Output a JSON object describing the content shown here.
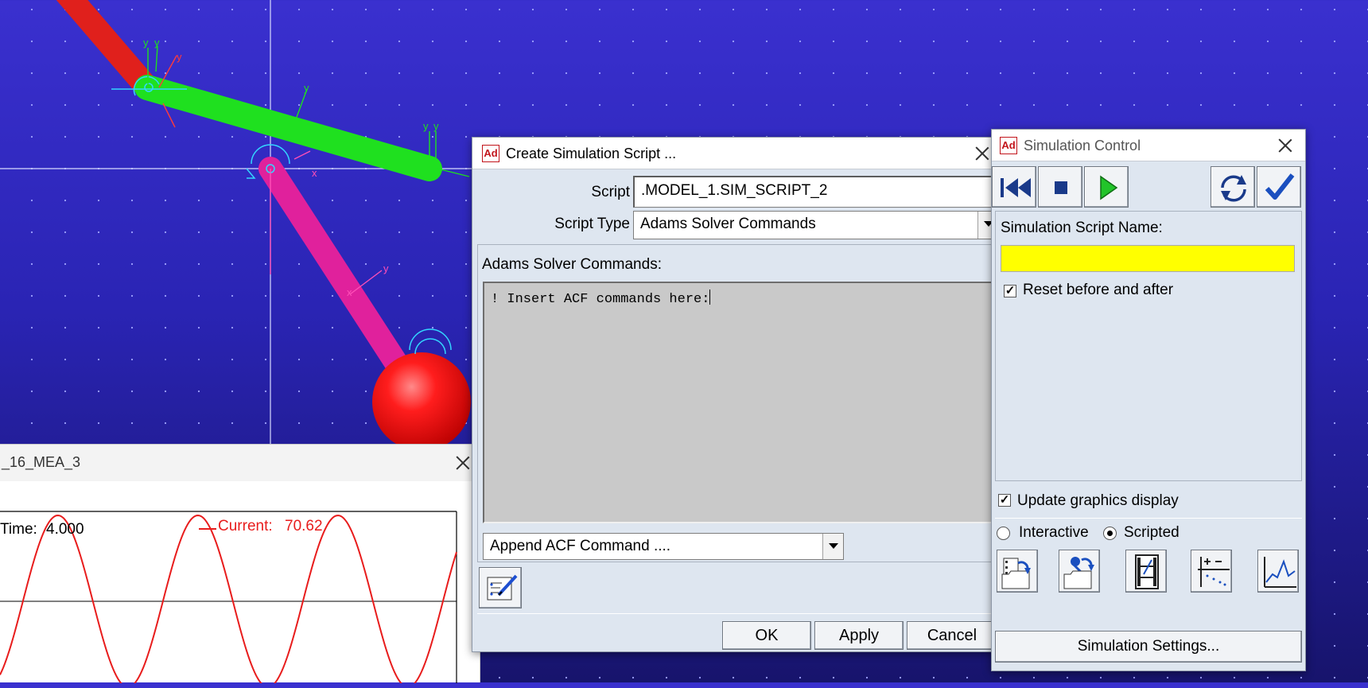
{
  "viewport": {
    "background_top": "#3a30cf",
    "background_bottom": "#17146c",
    "links": [
      {
        "name": "ground-link",
        "color": "#e0201c"
      },
      {
        "name": "coupler-link",
        "color": "#1fe01f"
      },
      {
        "name": "crank-link",
        "color": "#e0219c"
      },
      {
        "name": "ball",
        "color": "#ff1a1a"
      }
    ],
    "axis_labels": {
      "y": "y",
      "x": "x"
    }
  },
  "measure_window": {
    "title": "_16_MEA_3",
    "time_label": "Time:",
    "time_value": "4.000",
    "current_label": "Current:",
    "current_value": "70.62",
    "curve_color": "#e81c1c"
  },
  "script_dialog": {
    "title": "Create Simulation Script ...",
    "script_label": "Script",
    "script_value": ".MODEL_1.SIM_SCRIPT_2",
    "script_type_label": "Script Type",
    "script_type_value": "Adams Solver Commands",
    "commands_label": "Adams Solver Commands:",
    "commands_text": "! Insert ACF commands here:",
    "append_combo": "Append ACF Command ....",
    "ok_label": "OK",
    "apply_label": "Apply",
    "cancel_label": "Cancel"
  },
  "sim_control": {
    "title": "Simulation Control",
    "script_name_label": "Simulation Script Name:",
    "script_name_value": "",
    "reset_label": "Reset before and after",
    "reset_checked": true,
    "update_graphics_label": "Update graphics display",
    "update_graphics_checked": true,
    "interactive_label": "Interactive",
    "scripted_label": "Scripted",
    "selected_mode": "Scripted",
    "settings_label": "Simulation Settings...",
    "field_color": "#ffff00",
    "accent_color": "#1e6ee0"
  }
}
